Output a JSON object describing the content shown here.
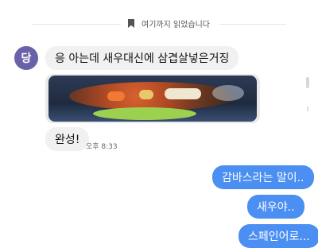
{
  "divider": {
    "text": "여기까지 읽었습니다"
  },
  "messages": {
    "sender_initial": "당",
    "incoming_1": "응 아는데 새우대신에 삼겹살넣은거징",
    "incoming_2": "완성!",
    "timestamp": "오후 8:33",
    "outgoing_1": "감바스라는 말이..",
    "outgoing_2": "새우야..",
    "outgoing_3": "스페인어로..."
  },
  "colors": {
    "outgoing_bubble": "#4a8ff1",
    "incoming_bubble": "#f1f1f1",
    "avatar": "#6a62a8"
  }
}
